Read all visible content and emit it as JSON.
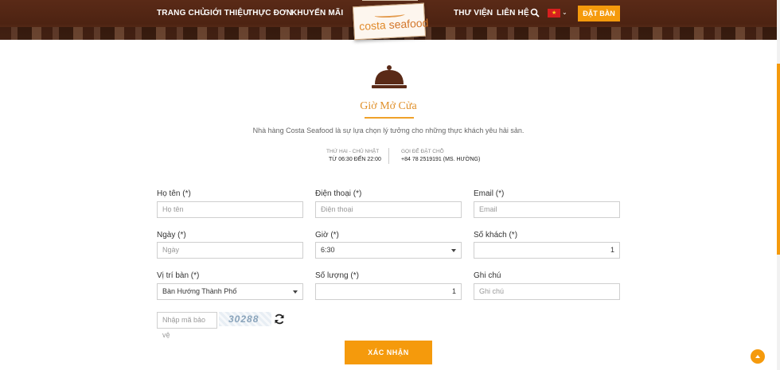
{
  "nav": {
    "left": [
      "TRANG CHỦ",
      "GIỚI THIỆU",
      "THỰC ĐƠN",
      "KHUYẾN MÃI"
    ],
    "right": [
      "THƯ VIỆN",
      "LIÊN HỆ"
    ],
    "book_label": "ĐẶT BÀN",
    "logo_word1": "costa",
    "logo_word2": "seafood"
  },
  "hours": {
    "title": "Giờ Mở Cửa",
    "intro": "Nhà hàng Costa Seafood là sự lựa chọn lý tưởng cho những thực khách yêu hải sản.",
    "left_label": "THỨ HAI - CHỦ NHẬT",
    "left_value": "TỪ 06:30 ĐẾN 22:00",
    "right_label": "GỌI ĐỂ ĐẶT CHỖ",
    "right_value": "+84 78 2519191 (MS. HƯỜNG)"
  },
  "form": {
    "name_label": "Họ tên (*)",
    "name_placeholder": "Họ tên",
    "phone_label": "Điện thoại (*)",
    "phone_placeholder": "Điện thoại",
    "email_label": "Email (*)",
    "email_placeholder": "Email",
    "date_label": "Ngày (*)",
    "date_placeholder": "Ngày",
    "time_label": "Giờ (*)",
    "time_value": "6:30",
    "guests_label": "Số khách (*)",
    "guests_value": "1",
    "table_label": "Vị trí bàn (*)",
    "table_value": "Bàn Hướng Thành Phố",
    "qty_label": "Số lượng (*)",
    "qty_value": "1",
    "note_label": "Ghi chú",
    "note_placeholder": "Ghi chú",
    "captcha_placeholder": "Nhập mã bảo vệ",
    "captcha_code": "30288",
    "submit_label": "XÁC NHẬN"
  },
  "colors": {
    "accent": "#f59a0c",
    "header": "#4d2312",
    "title": "#e0902a"
  }
}
